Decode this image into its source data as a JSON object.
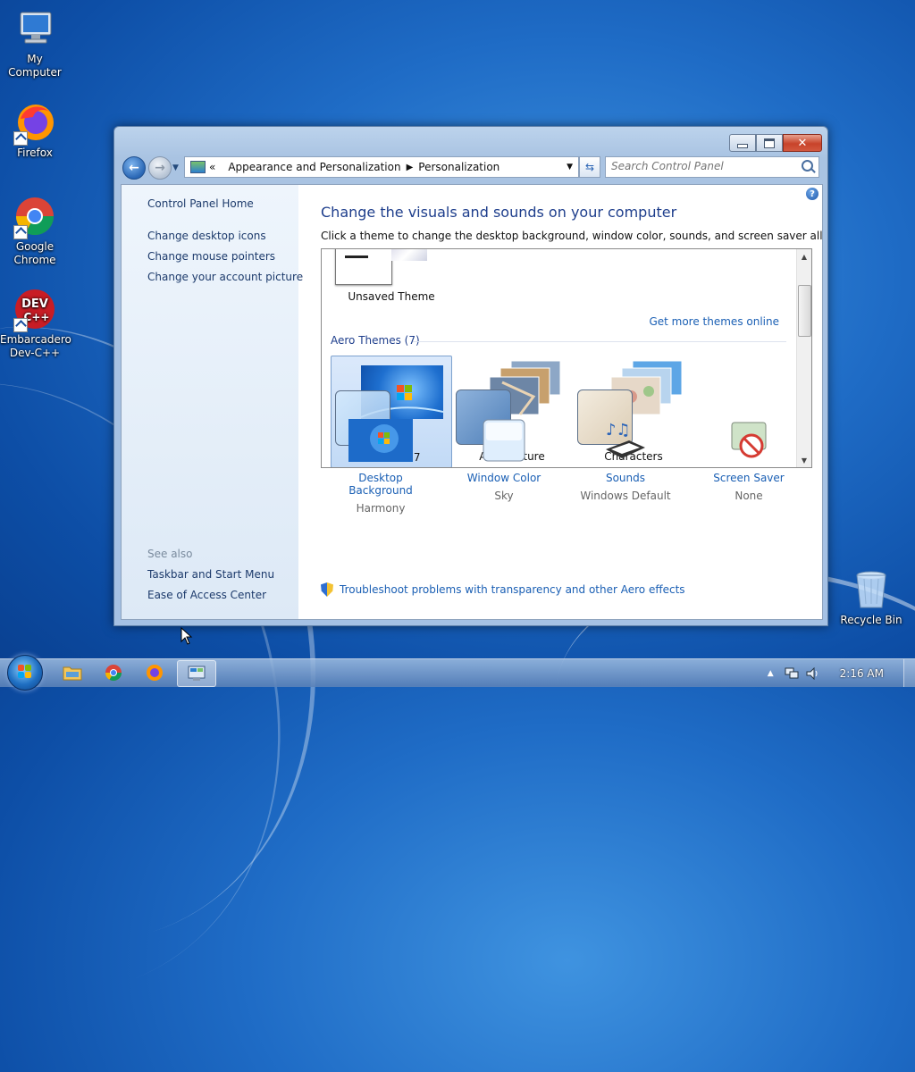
{
  "desktop": {
    "icons": [
      {
        "label": "My Computer",
        "icon": "computer-icon"
      },
      {
        "label": "Firefox",
        "icon": "firefox-icon"
      },
      {
        "label": "Google Chrome",
        "icon": "chrome-icon"
      },
      {
        "label": "Embarcadero Dev-C++",
        "icon": "devcpp-icon"
      },
      {
        "label": "Recycle Bin",
        "icon": "recycle-bin-icon"
      }
    ]
  },
  "window": {
    "address": {
      "overflow": "«",
      "crumbs": [
        "Appearance and Personalization",
        "Personalization"
      ]
    },
    "search": {
      "placeholder": "Search Control Panel"
    }
  },
  "left_pane": {
    "home": "Control Panel Home",
    "links": [
      "Change desktop icons",
      "Change mouse pointers",
      "Change your account picture"
    ],
    "see_also_title": "See also",
    "see_also": [
      "Taskbar and Start Menu",
      "Ease of Access Center"
    ]
  },
  "main": {
    "heading": "Change the visuals and sounds on your computer",
    "subheading": "Click a theme to change the desktop background, window color, sounds, and screen saver all at once.",
    "unsaved_theme": "Unsaved Theme",
    "get_more": "Get more themes online",
    "aero_group": "Aero Themes (7)",
    "themes": [
      {
        "name": "Windows 7",
        "selected": true
      },
      {
        "name": "Architecture",
        "selected": false
      },
      {
        "name": "Characters",
        "selected": false
      }
    ],
    "options": [
      {
        "label": "Desktop Background",
        "value": "Harmony",
        "icon": "desktop-background-icon"
      },
      {
        "label": "Window Color",
        "value": "Sky",
        "icon": "window-color-icon"
      },
      {
        "label": "Sounds",
        "value": "Windows Default",
        "icon": "sounds-icon"
      },
      {
        "label": "Screen Saver",
        "value": "None",
        "icon": "screen-saver-icon"
      }
    ],
    "troubleshoot": "Troubleshoot problems with transparency and other Aero effects"
  },
  "taskbar": {
    "clock": "2:16 AM",
    "pinned": [
      "explorer-icon",
      "chrome-icon",
      "firefox-icon",
      "control-panel-icon"
    ]
  },
  "colors": {
    "link": "#1a5fb4",
    "heading": "#1e3e8c",
    "close_button": "#c8432a",
    "desktop": "#1f6cc6"
  }
}
